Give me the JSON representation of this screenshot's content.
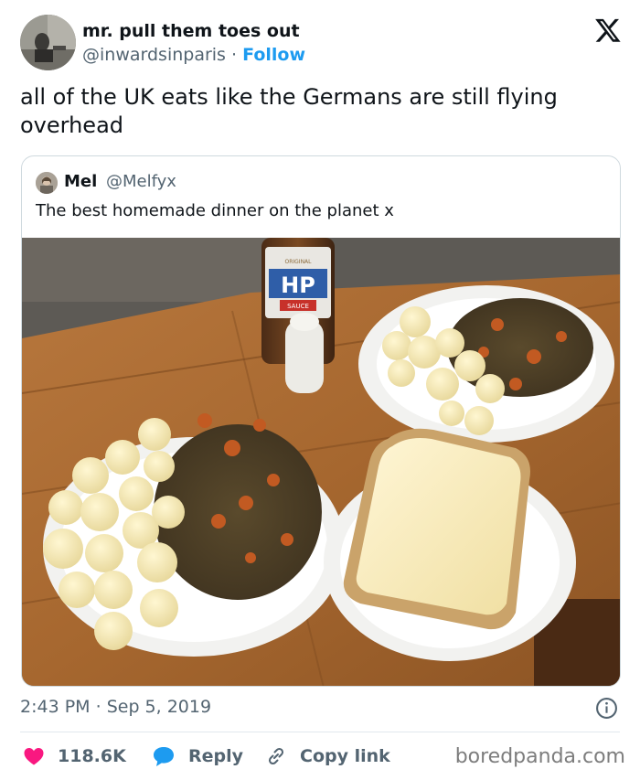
{
  "author": {
    "name": "mr. pull them toes out",
    "handle": "@inwardsinparis",
    "separator": "·",
    "follow_label": "Follow"
  },
  "tweet": {
    "text": "all of the UK eats like the Germans are still flying overhead"
  },
  "quoted_tweet": {
    "name": "Mel",
    "handle": "@Melfyx",
    "text": "The best homemade dinner on the planet x",
    "bottle_brand": "HP",
    "bottle_label_top": "ORIGINAL",
    "bottle_label_bottom": "SAUCE"
  },
  "meta": {
    "time": "2:43 PM",
    "separator": "·",
    "date": "Sep 5, 2019"
  },
  "actions": {
    "likes": "118.6K",
    "reply_label": "Reply",
    "copy_label": "Copy link"
  },
  "watermark": "boredpanda.com",
  "colors": {
    "like": "#f91880",
    "reply": "#1d9bf0",
    "link": "#1d9bf0",
    "muted": "#536471"
  }
}
